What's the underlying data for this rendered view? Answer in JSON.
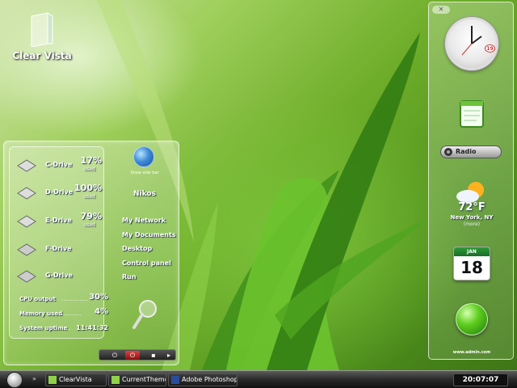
{
  "desktop": {
    "icon_label": "Clear Vista"
  },
  "drives": [
    {
      "name": "C-Drive",
      "percent": "17%",
      "used": "used"
    },
    {
      "name": "D-Drive",
      "percent": "100%",
      "used": "used"
    },
    {
      "name": "E-Drive",
      "percent": "79%",
      "used": "used"
    },
    {
      "name": "F-Drive",
      "percent": "",
      "used": ""
    },
    {
      "name": "G-Drive",
      "percent": "",
      "used": ""
    }
  ],
  "stats": [
    {
      "label": "CPU output",
      "dots": "...............",
      "value": "30%"
    },
    {
      "label": "Memory used",
      "dots": "...........",
      "value": "4%"
    },
    {
      "label": "System uptime",
      "dots": ".....",
      "value": "11:41:32"
    }
  ],
  "user_panel": {
    "show_side_text": "Show side bar",
    "username": "Nikos",
    "links": [
      "My Network",
      "My Documents",
      "Desktop",
      "Control panel",
      "Run"
    ]
  },
  "sidebar": {
    "close_glyph": "✕",
    "clock_date": "19",
    "radio_label": "Radio",
    "weather": {
      "temp": "72°F",
      "city": "New York, NY",
      "more": "(more)"
    },
    "calendar": {
      "month": "JAN",
      "day": "18"
    },
    "site": "www.admin.com"
  },
  "taskbar": {
    "chevron": "»",
    "tasks": [
      {
        "label": "ClearVista",
        "icon": "notepad-icon"
      },
      {
        "label": "CurrentTheme",
        "icon": "notepad-icon"
      },
      {
        "label": "Adobe Photoshop ...",
        "icon": "photoshop-icon"
      }
    ],
    "clock": "20:07:07"
  },
  "colors": {
    "accent_green": "#5ece1e",
    "power_red": "#c22"
  }
}
